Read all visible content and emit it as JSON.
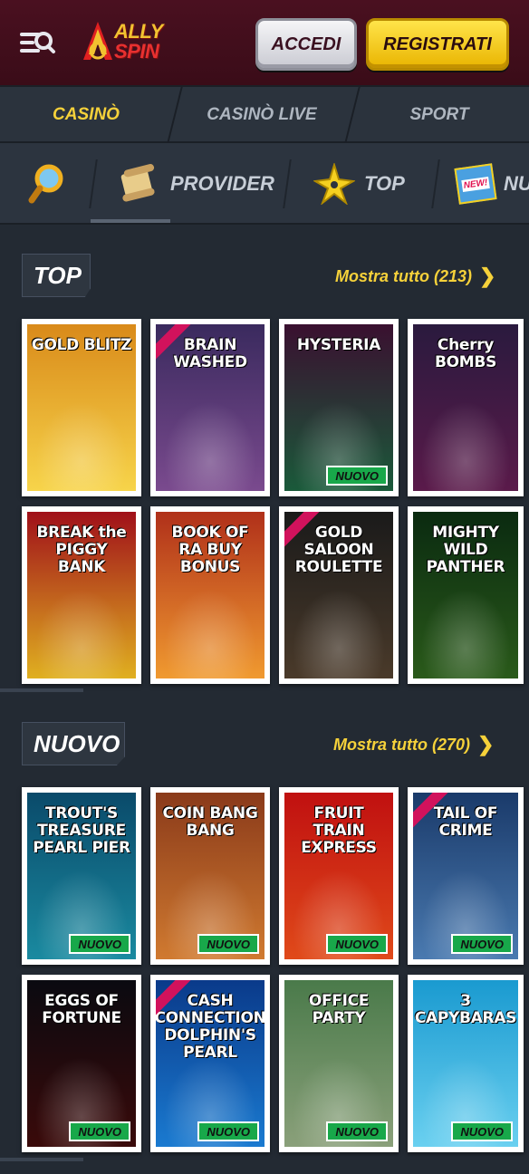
{
  "header": {
    "logo_line1": "ALLY",
    "logo_line2": "SPIN",
    "login_label": "ACCEDI",
    "register_label": "REGISTRATI"
  },
  "main_tabs": [
    {
      "label": "CASINÒ",
      "active": true
    },
    {
      "label": "CASINÒ LIVE",
      "active": false
    },
    {
      "label": "SPORT",
      "active": false
    }
  ],
  "sub_nav": {
    "items": [
      {
        "label": "PROVIDER",
        "icon": "scroll-icon"
      },
      {
        "label": "TOP",
        "icon": "star-icon"
      },
      {
        "label": "NU",
        "icon": "new-badge-icon",
        "badge_text": "NEW!"
      }
    ]
  },
  "sections": [
    {
      "title": "TOP",
      "show_all": "Mostra tutto (213)",
      "games": [
        {
          "title": "GOLD BLITZ",
          "badge": "",
          "exclusive": false,
          "bg": "#d98a1a",
          "bg2": "#f7d44a"
        },
        {
          "title": "BRAIN WASHED",
          "badge": "",
          "exclusive": true,
          "bg": "#3a2a5e",
          "bg2": "#7a4a8e"
        },
        {
          "title": "HYSTERIA",
          "badge": "NUOVO",
          "exclusive": false,
          "bg": "#3a1030",
          "bg2": "#1a5a3a"
        },
        {
          "title": "Cherry BOMBS",
          "badge": "",
          "exclusive": false,
          "bg": "#2a1a3e",
          "bg2": "#5a1a4a"
        },
        {
          "title": "BREAK the PIGGY BANK",
          "badge": "",
          "exclusive": false,
          "bg": "#a0101a",
          "bg2": "#e0b020"
        },
        {
          "title": "BOOK OF RA BUY BONUS",
          "badge": "",
          "exclusive": false,
          "bg": "#b0301a",
          "bg2": "#f09a30"
        },
        {
          "title": "GOLD SALOON ROULETTE",
          "badge": "",
          "exclusive": true,
          "bg": "#1a1a1a",
          "bg2": "#4a3a2a"
        },
        {
          "title": "MIGHTY WILD PANTHER",
          "badge": "",
          "exclusive": false,
          "bg": "#0a2a10",
          "bg2": "#2a5a1a"
        }
      ]
    },
    {
      "title": "NUOVO",
      "show_all": "Mostra tutto (270)",
      "games": [
        {
          "title": "TROUT'S TREASURE PEARL PIER",
          "badge": "NUOVO",
          "exclusive": false,
          "bg": "#0a4a6a",
          "bg2": "#1a8aa0"
        },
        {
          "title": "COIN BANG BANG",
          "badge": "NUOVO",
          "exclusive": false,
          "bg": "#8a3a1a",
          "bg2": "#d07a30"
        },
        {
          "title": "FRUIT TRAIN EXPRESS",
          "badge": "NUOVO",
          "exclusive": false,
          "bg": "#c01010",
          "bg2": "#e04a1a"
        },
        {
          "title": "TAIL OF CRIME",
          "badge": "NUOVO",
          "exclusive": true,
          "bg": "#1a3a6a",
          "bg2": "#4a7ab0"
        },
        {
          "title": "EGGS OF FORTUNE",
          "badge": "NUOVO",
          "exclusive": false,
          "bg": "#0a0a10",
          "bg2": "#3a0a0a"
        },
        {
          "title": "CASH CONNECTION DOLPHIN'S PEARL",
          "badge": "NUOVO",
          "exclusive": true,
          "bg": "#0a3a8a",
          "bg2": "#1a7ad0"
        },
        {
          "title": "OFFICE PARTY",
          "badge": "NUOVO",
          "exclusive": false,
          "bg": "#4a7a4a",
          "bg2": "#8aa07a"
        },
        {
          "title": "3 CAPYBARAS",
          "badge": "NUOVO",
          "exclusive": false,
          "bg": "#1a9ad0",
          "bg2": "#6ad0f0"
        }
      ]
    }
  ]
}
